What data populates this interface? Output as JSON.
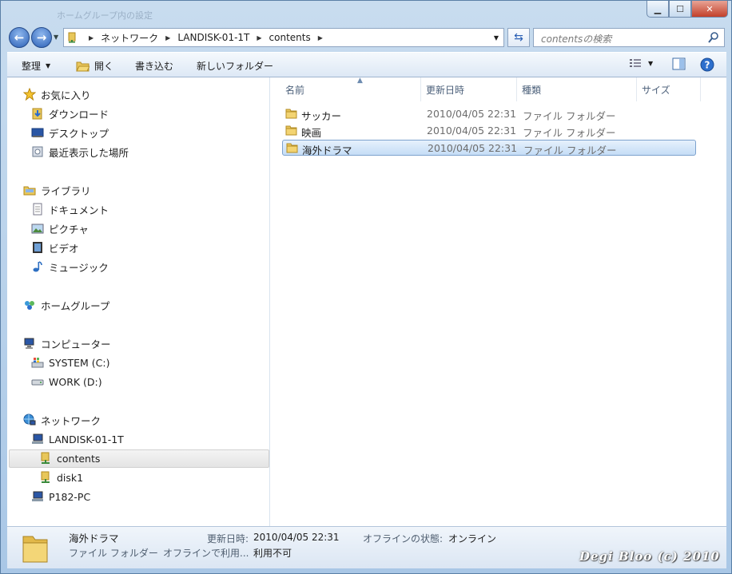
{
  "window": {
    "title": "ホームグループ内の設定",
    "controls": [
      "minimize",
      "maximize",
      "close"
    ]
  },
  "navigation": {
    "breadcrumbs": [
      "ネットワーク",
      "LANDISK-01-1T",
      "contents"
    ],
    "search_placeholder": "contentsの検索"
  },
  "toolbar": {
    "organize": "整理",
    "open": "開く",
    "burn": "書き込む",
    "new_folder": "新しいフォルダー"
  },
  "sidebar": {
    "favorites": {
      "label": "お気に入り",
      "items": [
        {
          "label": "ダウンロード",
          "icon": "download-folder-icon"
        },
        {
          "label": "デスクトップ",
          "icon": "desktop-icon"
        },
        {
          "label": "最近表示した場所",
          "icon": "recent-places-icon"
        }
      ]
    },
    "libraries": {
      "label": "ライブラリ",
      "items": [
        {
          "label": "ドキュメント",
          "icon": "documents-icon"
        },
        {
          "label": "ピクチャ",
          "icon": "pictures-icon"
        },
        {
          "label": "ビデオ",
          "icon": "video-icon"
        },
        {
          "label": "ミュージック",
          "icon": "music-icon"
        }
      ]
    },
    "homegroup": {
      "label": "ホームグループ"
    },
    "computer": {
      "label": "コンピューター",
      "items": [
        {
          "label": "SYSTEM (C:)",
          "icon": "system-drive-icon"
        },
        {
          "label": "WORK (D:)",
          "icon": "drive-icon"
        }
      ]
    },
    "network": {
      "label": "ネットワーク",
      "items": [
        {
          "label": "LANDISK-01-1T",
          "icon": "network-computer-icon"
        },
        {
          "label": "contents",
          "icon": "network-share-icon",
          "selected": true
        },
        {
          "label": "disk1",
          "icon": "network-share-icon"
        },
        {
          "label": "P182-PC",
          "icon": "network-computer-icon"
        }
      ]
    }
  },
  "columns": [
    "名前",
    "更新日時",
    "種類",
    "サイズ"
  ],
  "files": [
    {
      "name": "サッカー",
      "date": "2010/04/05 22:31",
      "type": "ファイル フォルダー"
    },
    {
      "name": "映画",
      "date": "2010/04/05 22:31",
      "type": "ファイル フォルダー"
    },
    {
      "name": "海外ドラマ",
      "date": "2010/04/05 22:31",
      "type": "ファイル フォルダー",
      "selected": true
    }
  ],
  "details": {
    "name": "海外ドラマ",
    "type": "ファイル フォルダー",
    "modified_label": "更新日時:",
    "modified_value": "2010/04/05 22:31",
    "offline_status_label": "オフラインの状態:",
    "offline_status_value": "オンライン",
    "offline_avail_label": "オフラインで利用...",
    "offline_avail_value": "利用不可"
  },
  "watermark": "Degi Bloo (c) 2010"
}
